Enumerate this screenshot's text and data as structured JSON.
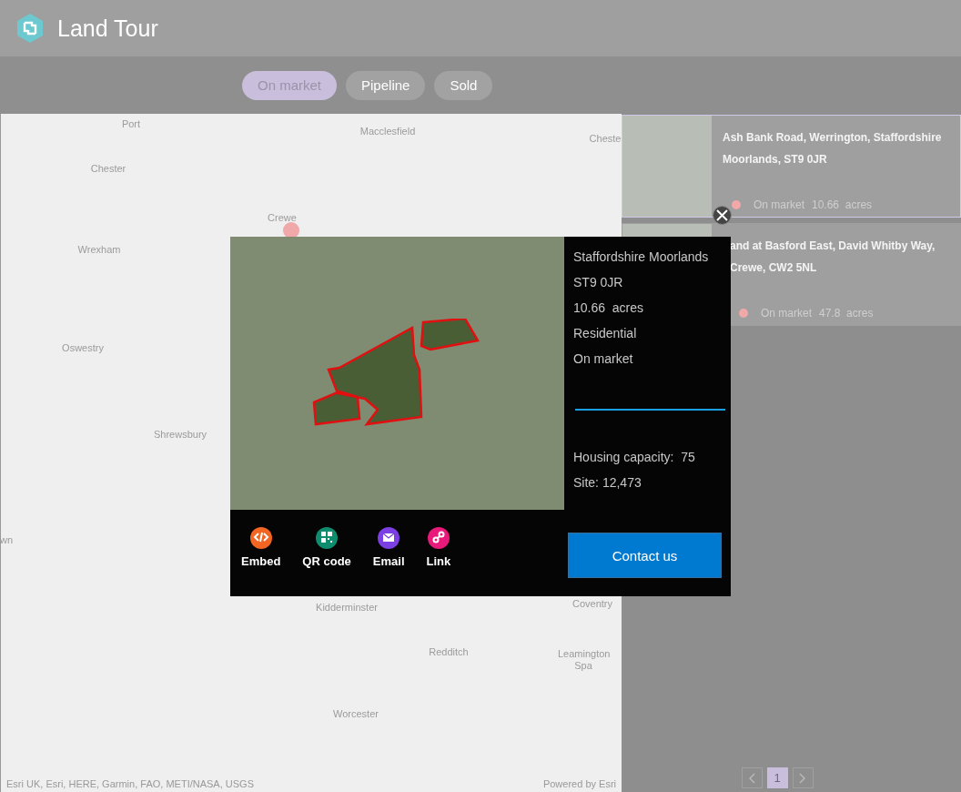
{
  "app": {
    "title": "Land Tour"
  },
  "filters": [
    {
      "label": "On market",
      "selected": true
    },
    {
      "label": "Pipeline",
      "selected": false
    },
    {
      "label": "Sold",
      "selected": false
    }
  ],
  "map": {
    "labels": [
      "Port",
      "Macclesfield",
      "Cheste",
      "Chester",
      "Crewe",
      "Wrexham",
      "Oswestry",
      "Shrewsbury",
      "wn",
      "Kidderminster",
      "Coventry",
      "Redditch",
      "Leamington Spa",
      "Worcester"
    ],
    "markers": [
      {
        "color": "#f0a8a8"
      }
    ],
    "attribution": "Esri UK, Esri, HERE, Garmin, FAO, METI/NASA, USGS",
    "powered_by": "Powered by Esri"
  },
  "popup": {
    "details": [
      "Staffordshire Moorlands",
      "ST9 0JR",
      "10.66  acres",
      "Residential",
      "On market"
    ],
    "extra": [
      "Housing capacity:  75",
      "Site: 12,473"
    ],
    "share": [
      {
        "label": "Embed",
        "kind": "embed",
        "color": "#f26522"
      },
      {
        "label": "QR code",
        "kind": "qr",
        "color": "#0f8c6e"
      },
      {
        "label": "Email",
        "kind": "email",
        "color": "#7b3fe4"
      },
      {
        "label": "Link",
        "kind": "link",
        "color": "#e8197a"
      }
    ],
    "contact_button": "Contact us"
  },
  "listings": [
    {
      "title_lines": [
        "Ash Bank Road, Werrington, Staffordshire",
        "Moorlands, ST9 0JR"
      ],
      "status": "On market",
      "size": "10.66  acres",
      "color": "#f0a8a8",
      "selected": true
    },
    {
      "title_lines": [
        "and at Basford East, David Whitby Way,",
        "Crewe, CW2 5NL"
      ],
      "status": "On market",
      "size": "47.8  acres",
      "color": "#f0a8a8",
      "selected": false
    }
  ],
  "pagination": {
    "pages": [
      {
        "label": "1",
        "selected": true
      }
    ]
  }
}
